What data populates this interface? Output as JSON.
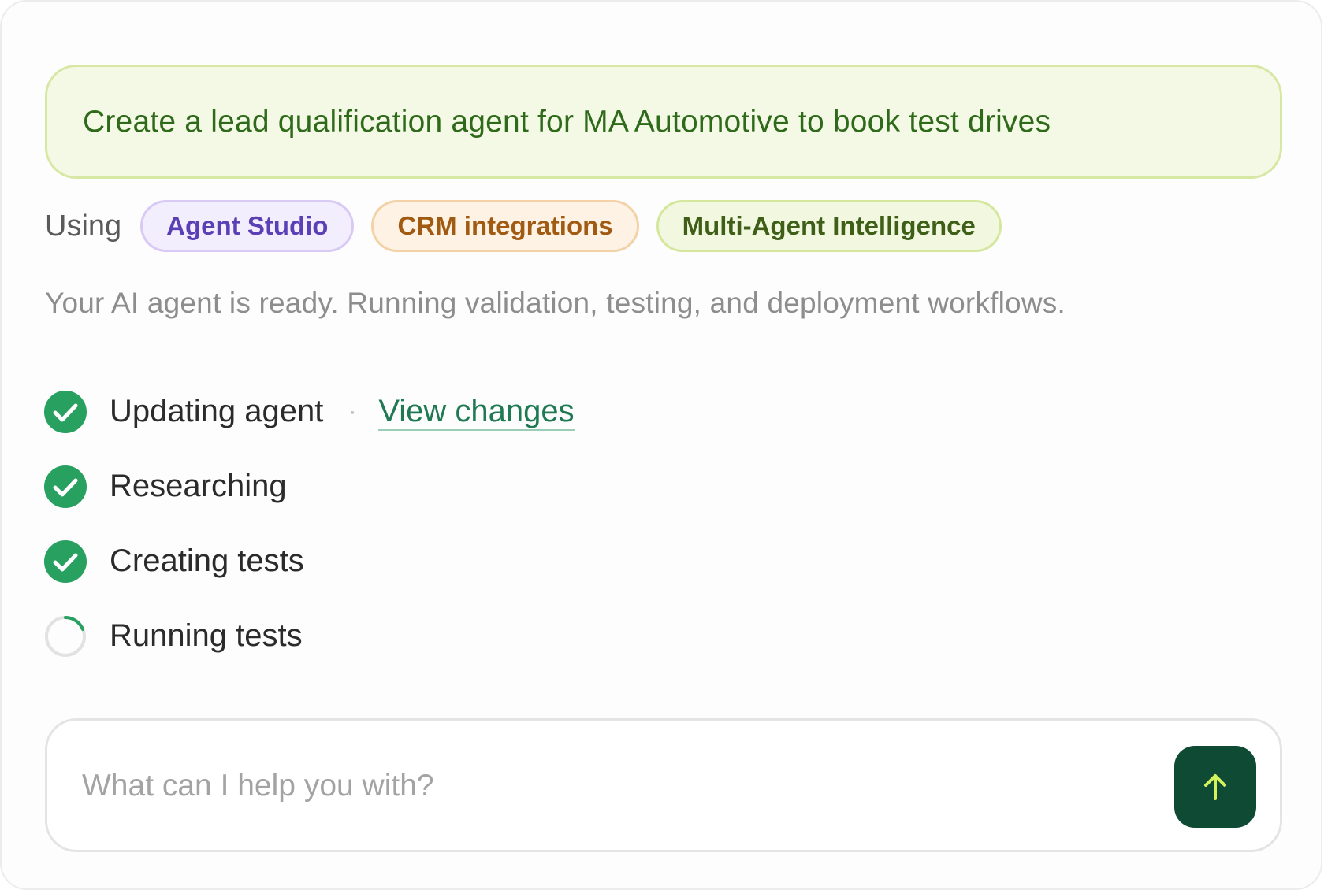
{
  "prompt": {
    "text": "Create a lead qualification agent for MA Automotive to book test drives"
  },
  "using": {
    "label": "Using",
    "chips": [
      {
        "label": "Agent Studio",
        "color": "#5b3fb5"
      },
      {
        "label": "CRM integrations",
        "color": "#a15a12"
      },
      {
        "label": "Multi-Agent Intelligence",
        "color": "#3f5e17"
      }
    ]
  },
  "status": {
    "text": "Your AI agent is ready. Running validation, testing, and deployment workflows."
  },
  "steps": [
    {
      "label": "Updating agent",
      "state": "done",
      "icon": "check-circle-icon",
      "link": "View changes",
      "separator": "·"
    },
    {
      "label": "Researching",
      "state": "done",
      "icon": "check-circle-icon"
    },
    {
      "label": "Creating tests",
      "state": "done",
      "icon": "check-circle-icon"
    },
    {
      "label": "Running tests",
      "state": "in-progress",
      "icon": "spinner-icon"
    }
  ],
  "chat_input": {
    "placeholder": "What can I help you with?",
    "value": ""
  },
  "send_button": {
    "icon": "arrow-up-icon",
    "color": "#0f4a35"
  },
  "colors": {
    "success": "#27a060",
    "link": "#1f7a54",
    "accent_icon": "#d4f25c"
  }
}
